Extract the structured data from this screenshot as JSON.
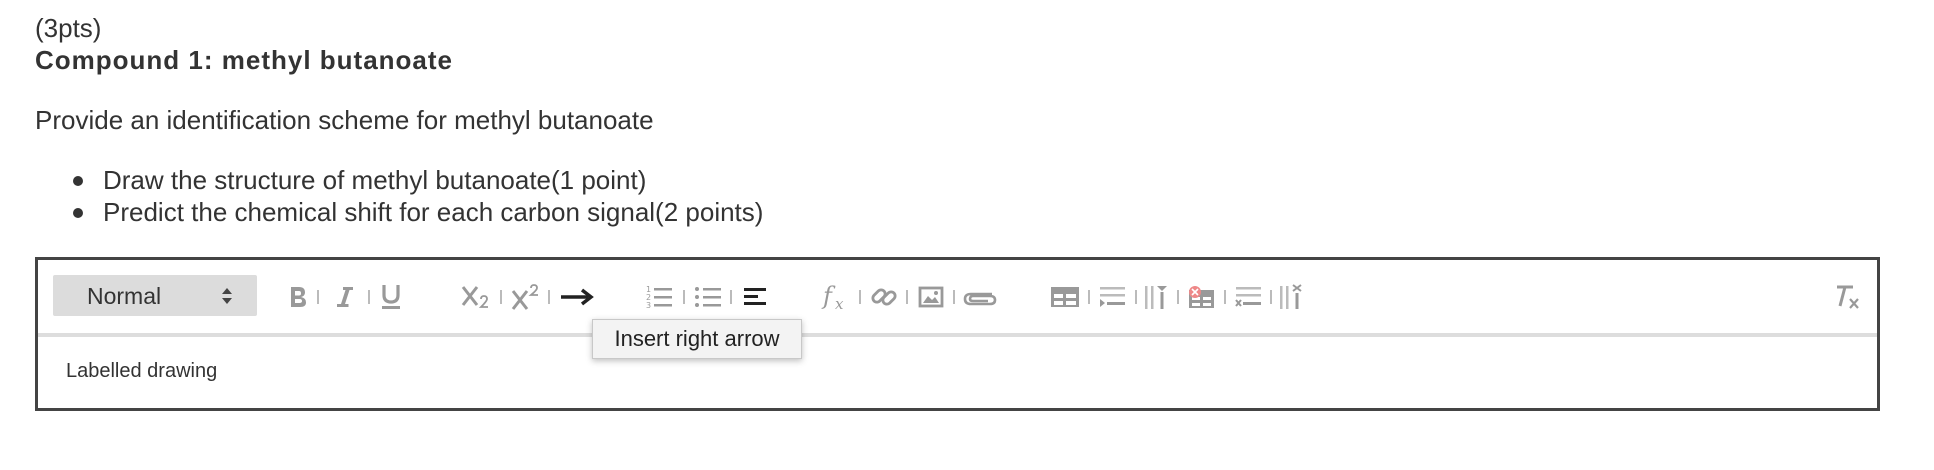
{
  "question": {
    "points": "(3pts)",
    "compound_heading": "Compound 1: methyl butanoate",
    "intro": "Provide an identification scheme for methyl butanoate",
    "bullets": [
      "Draw the structure of methyl butanoate(1 point)",
      "Predict the chemical shift for each carbon signal(2 points)"
    ]
  },
  "editor": {
    "format_select": {
      "value": "Normal"
    },
    "toolbar_icons": [
      "bold-icon",
      "italic-icon",
      "underline-icon",
      "subscript-icon",
      "superscript-icon",
      "right-arrow-icon",
      "ordered-list-icon",
      "bullet-list-icon",
      "align-icon",
      "formula-icon",
      "link-icon",
      "image-icon",
      "attachment-icon",
      "table-icon",
      "insert-row-icon",
      "insert-column-icon",
      "delete-table-icon",
      "delete-row-icon",
      "delete-column-icon",
      "clear-format-icon"
    ],
    "content": "Labelled drawing",
    "tooltip": "Insert right arrow"
  },
  "colors": {
    "icon": "#999999",
    "text": "#333333",
    "toolbar_divider": "#dddddd",
    "border": "#444444",
    "select_bg": "#dcdcdc"
  }
}
